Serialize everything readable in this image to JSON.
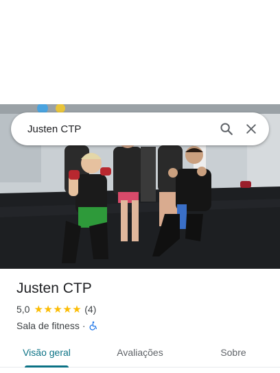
{
  "search": {
    "query": "Justen CTP"
  },
  "place": {
    "title": "Justen CTP",
    "rating": "5,0",
    "stars": 5,
    "review_count": "(4)",
    "category": "Sala de fitness",
    "separator": "·",
    "accessibility_icon": "wheelchair-icon"
  },
  "tabs": [
    {
      "label": "Visão geral",
      "active": true
    },
    {
      "label": "Avaliações",
      "active": false
    },
    {
      "label": "Sobre",
      "active": false
    }
  ],
  "colors": {
    "star": "#fbbc04",
    "accent": "#0b7285",
    "accessibility_icon": "#1a73e8"
  }
}
